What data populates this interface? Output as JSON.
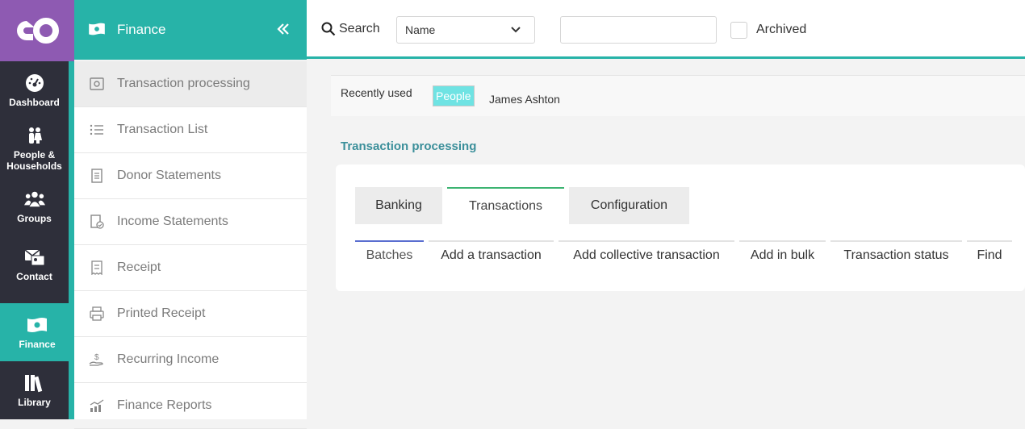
{
  "rail": {
    "items": [
      {
        "label": "Dashboard",
        "icon": "dashboard-icon"
      },
      {
        "label": "People & Households",
        "icon": "people-icon"
      },
      {
        "label": "Groups",
        "icon": "groups-icon"
      },
      {
        "label": "Contact",
        "icon": "contact-icon"
      },
      {
        "label": "Finance",
        "icon": "finance-icon",
        "active": true
      },
      {
        "label": "Library",
        "icon": "library-icon"
      }
    ]
  },
  "finance": {
    "title": "Finance",
    "menu": [
      {
        "label": "Transaction processing",
        "icon": "cash-register-icon",
        "active": true
      },
      {
        "label": "Transaction List",
        "icon": "list-icon"
      },
      {
        "label": "Donor Statements",
        "icon": "document-icon"
      },
      {
        "label": "Income Statements",
        "icon": "document-check-icon"
      },
      {
        "label": "Receipt",
        "icon": "receipt-icon"
      },
      {
        "label": "Printed Receipt",
        "icon": "printer-icon"
      },
      {
        "label": "Recurring Income",
        "icon": "hand-dollar-icon"
      },
      {
        "label": "Finance Reports",
        "icon": "chart-icon"
      }
    ]
  },
  "topbar": {
    "search_label": "Search",
    "select_value": "Name",
    "input_value": "",
    "archived_label": "Archived",
    "archived_checked": false
  },
  "recent": {
    "label": "Recently used",
    "pill": "People",
    "name": "James Ashton"
  },
  "page_title": "Transaction processing",
  "tabs": [
    {
      "label": "Banking",
      "active": false
    },
    {
      "label": "Transactions",
      "active": true
    },
    {
      "label": "Configuration",
      "active": false
    }
  ],
  "subtabs": [
    {
      "label": "Batches",
      "active": true
    },
    {
      "label": "Add a transaction",
      "active": false
    },
    {
      "label": "Add collective transaction",
      "active": false
    },
    {
      "label": "Add in bulk",
      "active": false
    },
    {
      "label": "Transaction status",
      "active": false
    },
    {
      "label": "Find",
      "active": false
    }
  ],
  "colors": {
    "teal": "#27b3a8",
    "purple": "#8e5ab2",
    "rail_dark": "#2e2f3a",
    "title_teal": "#3b8f9a"
  }
}
